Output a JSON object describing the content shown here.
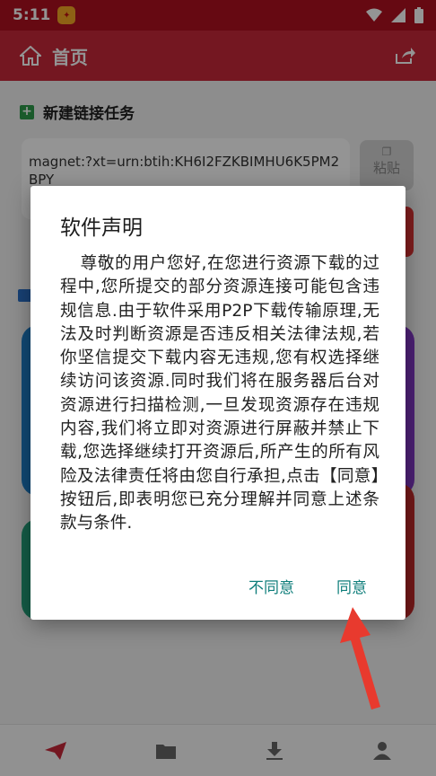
{
  "status_bar": {
    "time": "5:11",
    "app_badge": ""
  },
  "app_bar": {
    "title": "首页",
    "home_icon": "home-icon",
    "share_icon": "share-icon"
  },
  "new_task": {
    "title": "新建链接任务",
    "magnet_text": "magnet:?xt=urn:btih:KH6I2FZKBIMHU6K5PM2BPY",
    "paste_label": "粘贴"
  },
  "dialog": {
    "title": "软件声明",
    "body": "尊敬的用户您好,在您进行资源下载的过程中,您所提交的部分资源连接可能包含违规信息.由于软件采用P2P下载传输原理,无法及时判断资源是否违反相关法律法规,若你坚信提交下载内容无违规,您有权选择继续访问该资源.同时我们将在服务器后台对资源进行扫描检测,一旦发现资源存在违规内容,我们将立即对资源进行屏蔽并禁止下载,您选择继续打开资源后,所产生的所有风险及法律责任将由您自行承担,点击【同意】按钮后,即表明您已充分理解并同意上述条款与条件.",
    "disagree_label": "不同意",
    "agree_label": "同意"
  },
  "bottom_nav": [
    "send-icon",
    "folder-icon",
    "download-icon",
    "user-icon"
  ],
  "colors": {
    "primary": "#c8283a",
    "accent": "#0f7e7b",
    "arrow": "#e83a2e"
  }
}
